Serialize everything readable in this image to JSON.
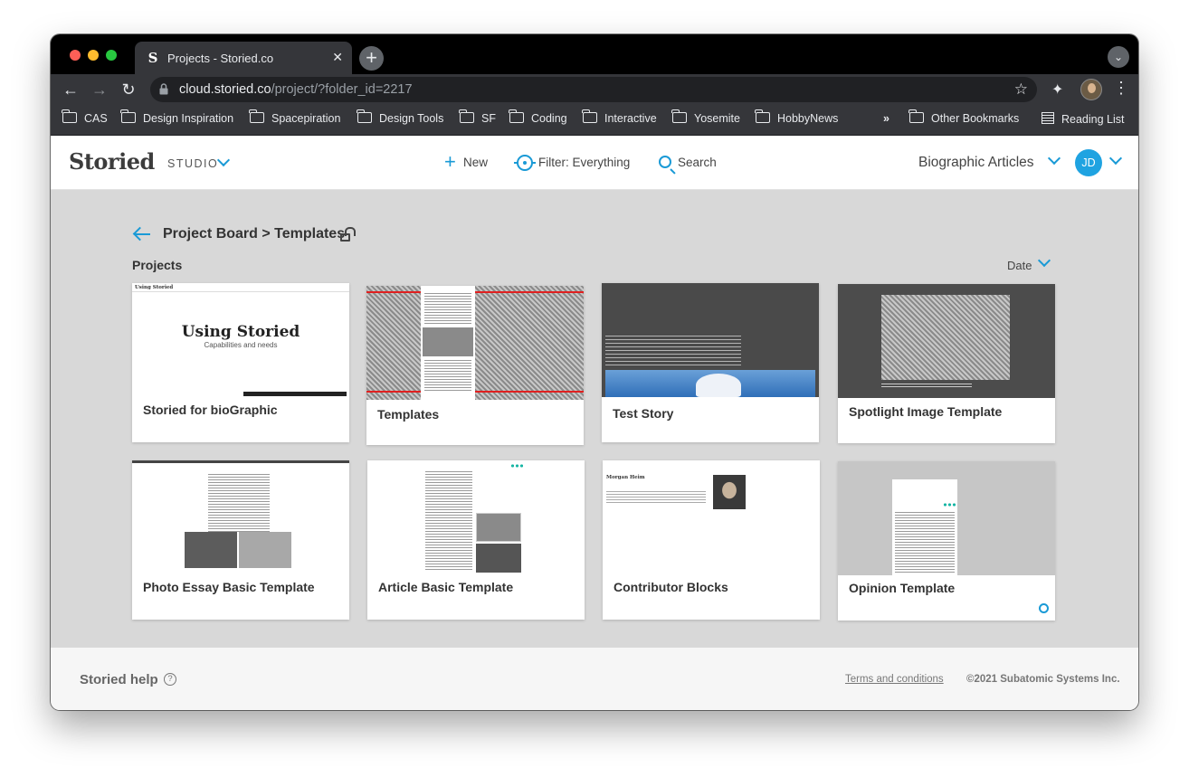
{
  "browser": {
    "tab_title": "Projects - Storied.co",
    "tab_favicon": "S",
    "url_host": "cloud.storied.co",
    "url_path": "/project/?folder_id=2217",
    "bookmarks": [
      "CAS",
      "Design Inspiration",
      "Spacepiration",
      "Design Tools",
      "SF",
      "Coding",
      "Interactive",
      "Yosemite",
      "HobbyNews"
    ],
    "bookmarks_overflow": "»",
    "other_bookmarks": "Other Bookmarks",
    "reading_list": "Reading List"
  },
  "header": {
    "logo": "Storied",
    "product": "STUDIO",
    "new_label": "New",
    "filter_label": "Filter:",
    "filter_value": "Everything",
    "search_label": "Search",
    "organization": "Biographic Articles",
    "user_initials": "JD"
  },
  "main": {
    "breadcrumb": "Project Board > Templates",
    "section_label": "Projects",
    "sort_label": "Date",
    "projects": [
      {
        "title": "Storied for bioGraphic",
        "thumb_heading": "Using Storied",
        "thumb_subtitle": "Capabilities and needs"
      },
      {
        "title": "Templates"
      },
      {
        "title": "Test Story"
      },
      {
        "title": "Spotlight Image Template"
      },
      {
        "title": "Photo Essay Basic Template"
      },
      {
        "title": "Article Basic Template"
      },
      {
        "title": "Contributor Blocks",
        "thumb_heading": "Morgan Heim"
      },
      {
        "title": "Opinion Template"
      }
    ]
  },
  "footer": {
    "help_label": "Storied help",
    "terms_label": "Terms and conditions",
    "copyright": "©2021 Subatomic Systems Inc."
  },
  "colors": {
    "accent": "#1a9ad6",
    "avatar": "#1fa3e1",
    "teal": "#19b6a5"
  },
  "icons": [
    "close-icon",
    "plus-icon",
    "back-arrow-icon",
    "forward-arrow-icon",
    "reload-icon",
    "lock-icon",
    "star-icon",
    "extensions-icon",
    "kebab-menu-icon",
    "folder-icon",
    "reading-list-icon",
    "chevron-down-icon",
    "crosshair-filter-icon",
    "search-icon",
    "unlock-icon",
    "help-icon",
    "loading-spinner-icon"
  ]
}
